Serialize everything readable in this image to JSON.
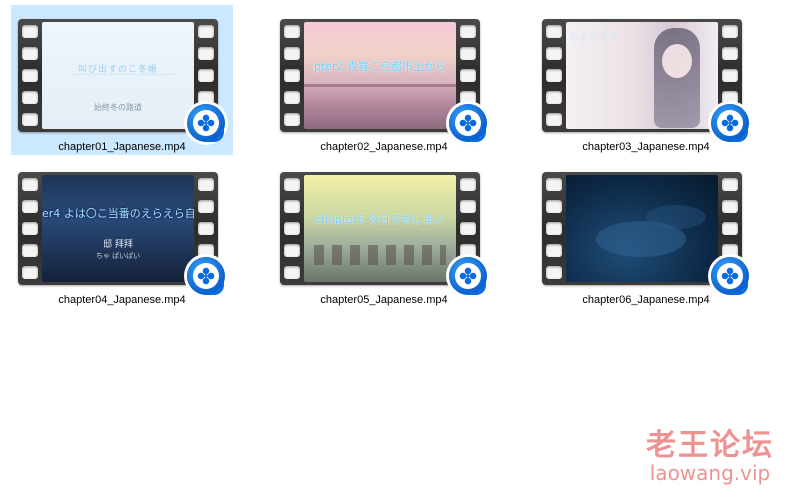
{
  "files": [
    {
      "name": "chapter01_Japanese.mp4",
      "selected": true,
      "thumb_style": "t1",
      "subtitles": [
        "叫び出すのこ冬帳",
        "始終冬の路道"
      ]
    },
    {
      "name": "chapter02_Japanese.mp4",
      "selected": false,
      "thumb_style": "t2",
      "subtitles": [
        "pter2 青春こ空都市上から"
      ]
    },
    {
      "name": "chapter03_Japanese.mp4",
      "selected": false,
      "thumb_style": "t3",
      "subtitles": [
        "ちょう あす"
      ]
    },
    {
      "name": "chapter04_Japanese.mp4",
      "selected": false,
      "thumb_style": "t4",
      "subtitles": [
        "er4 よは〇こ当番のえらえら自宅",
        "邸 拜拜",
        "ちゃ ぱいぱい"
      ]
    },
    {
      "name": "chapter05_Japanese.mp4",
      "selected": false,
      "thumb_style": "t5",
      "subtitles": [
        "chapter5 今日でおしまい"
      ]
    },
    {
      "name": "chapter06_Japanese.mp4",
      "selected": false,
      "thumb_style": "t6",
      "subtitles": []
    }
  ],
  "icons": {
    "file_type": "film-strip-icon",
    "associated_app": "video-player-badge-icon"
  },
  "colors": {
    "selection_background": "#cce8ff",
    "player_badge": "#0a6be0",
    "watermark": "#e86e6e"
  },
  "watermark": {
    "title": "老王论坛",
    "url": "laowang.vip"
  }
}
